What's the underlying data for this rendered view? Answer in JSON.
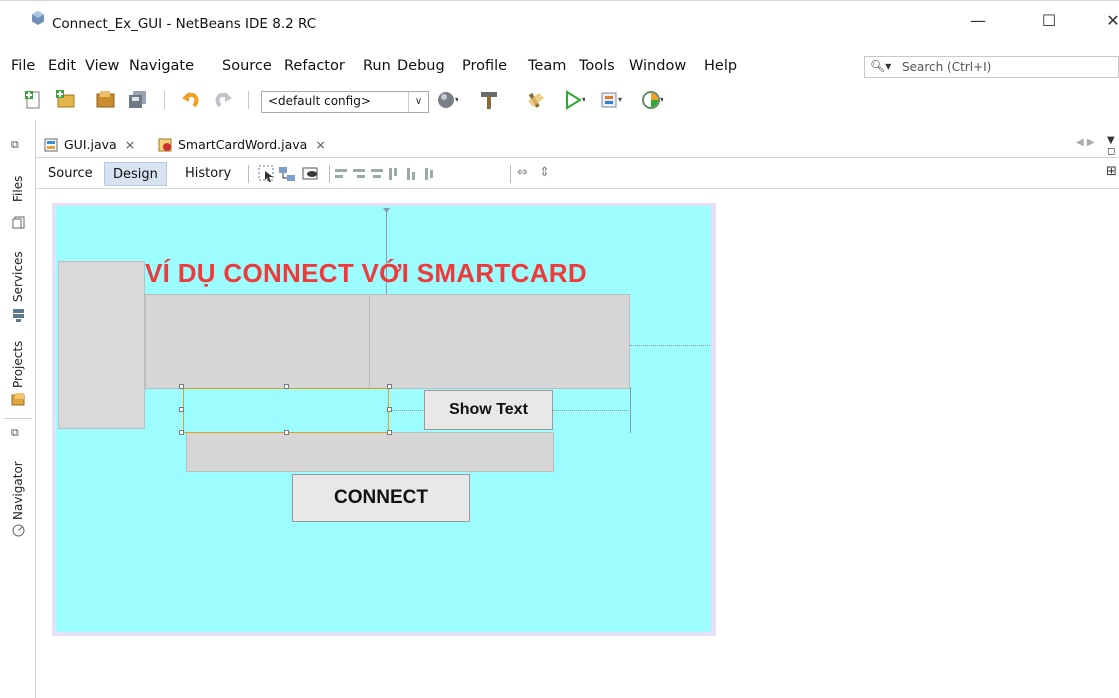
{
  "window": {
    "title": "Connect_Ex_GUI - NetBeans IDE 8.2 RC",
    "minimize": "—",
    "maximize": "☐",
    "close": "✕"
  },
  "menu": [
    "File",
    "Edit",
    "View",
    "Navigate",
    "Source",
    "Refactor",
    "Run",
    "Debug",
    "Profile",
    "Team",
    "Tools",
    "Window",
    "Help"
  ],
  "search": {
    "placeholder": "Search (Ctrl+I)",
    "icon": "search-icon"
  },
  "toolbar": {
    "config": "<default config>",
    "icons": [
      "new-file-icon",
      "new-project-icon",
      "open-project-icon",
      "save-all-icon",
      "undo-icon",
      "redo-icon",
      "build-globe-icon",
      "clean-build-icon",
      "build-hammer-icon",
      "run-icon",
      "debug-icon",
      "profile-icon"
    ]
  },
  "side_panel": {
    "tabs": [
      "Files",
      "Services",
      "Projects",
      "Navigator"
    ]
  },
  "editor_tabs": [
    {
      "label": "GUI.java",
      "close": "×"
    },
    {
      "label": "SmartCardWord.java",
      "close": "×"
    }
  ],
  "view_tabs": {
    "source": "Source",
    "design": "Design",
    "history": "History"
  },
  "form": {
    "heading": "VÍ DỤ CONNECT VỚI SMARTCARD",
    "show_text_button": "Show Text",
    "connect_button": "CONNECT"
  },
  "colors": {
    "canvas_bg": "#9dfcfe",
    "heading": "#ee3a3a",
    "selection": "#e0a020",
    "panel_gray": "#d6d6d6"
  }
}
